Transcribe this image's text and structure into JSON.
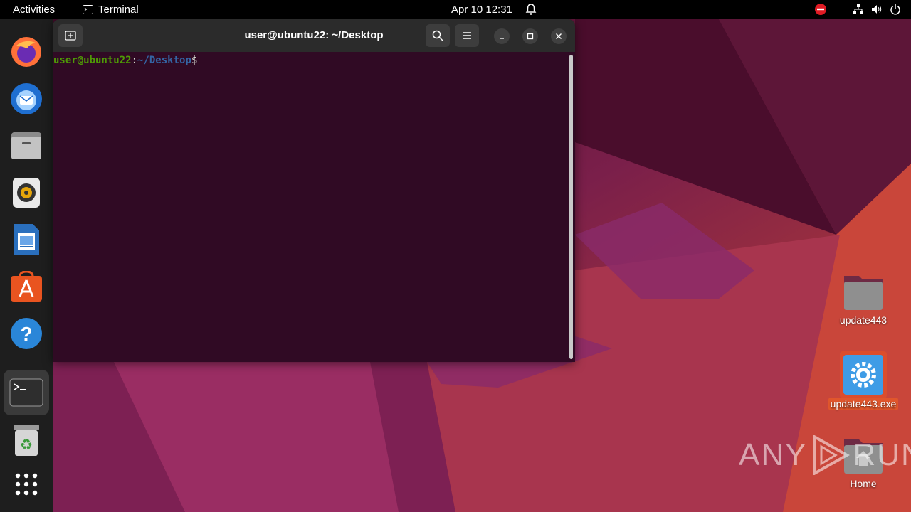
{
  "topbar": {
    "activities": "Activities",
    "app_name": "Terminal",
    "clock": "Apr 10  12:31"
  },
  "dock": {
    "items": [
      {
        "name": "Firefox",
        "icon": "firefox-icon"
      },
      {
        "name": "Thunderbird",
        "icon": "thunderbird-icon"
      },
      {
        "name": "Files",
        "icon": "files-icon"
      },
      {
        "name": "Rhythmbox",
        "icon": "rhythmbox-icon"
      },
      {
        "name": "LibreOffice Writer",
        "icon": "writer-icon"
      },
      {
        "name": "Ubuntu Software",
        "icon": "software-icon"
      },
      {
        "name": "Help",
        "icon": "help-icon"
      },
      {
        "name": "Terminal",
        "icon": "terminal-icon"
      },
      {
        "name": "Trash",
        "icon": "trash-icon"
      },
      {
        "name": "Show Applications",
        "icon": "app-grid-icon"
      }
    ]
  },
  "terminal": {
    "title": "user@ubuntu22: ~/Desktop",
    "prompt_user": "user@ubuntu22",
    "prompt_sep": ":",
    "prompt_path": "~/Desktop",
    "prompt_symbol": "$"
  },
  "desktop": {
    "icons": [
      {
        "label": "update443"
      },
      {
        "label": "update443.exe"
      },
      {
        "label": "Home"
      }
    ]
  },
  "watermark": {
    "left": "ANY",
    "right": "RUN"
  },
  "colors": {
    "accent": "#e95420",
    "terminal_bg": "#300a24",
    "prompt_user": "#4e9a06",
    "prompt_path": "#3465a4"
  }
}
